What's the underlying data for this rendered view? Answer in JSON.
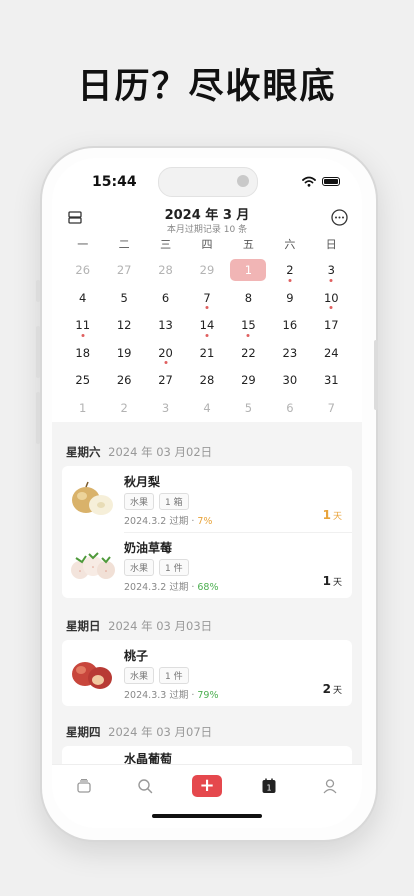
{
  "headline": "日历？尽收眼底",
  "status": {
    "time": "15:44"
  },
  "calendar": {
    "title": "2024 年 3 月",
    "subtitle": "本月过期记录 10 条",
    "weekdays": [
      "一",
      "二",
      "三",
      "四",
      "五",
      "六",
      "日"
    ],
    "weeks": [
      [
        {
          "d": "26",
          "muted": true
        },
        {
          "d": "27",
          "muted": true
        },
        {
          "d": "28",
          "muted": true
        },
        {
          "d": "29",
          "muted": true
        },
        {
          "d": "1",
          "today": true
        },
        {
          "d": "2",
          "dot": true
        },
        {
          "d": "3",
          "dot": true
        }
      ],
      [
        {
          "d": "4"
        },
        {
          "d": "5"
        },
        {
          "d": "6"
        },
        {
          "d": "7",
          "dot": true
        },
        {
          "d": "8"
        },
        {
          "d": "9"
        },
        {
          "d": "10",
          "dot": true
        }
      ],
      [
        {
          "d": "11",
          "dot": true
        },
        {
          "d": "12"
        },
        {
          "d": "13"
        },
        {
          "d": "14",
          "dot": true
        },
        {
          "d": "15",
          "dot": true
        },
        {
          "d": "16"
        },
        {
          "d": "17"
        }
      ],
      [
        {
          "d": "18"
        },
        {
          "d": "19"
        },
        {
          "d": "20",
          "dot": true
        },
        {
          "d": "21"
        },
        {
          "d": "22"
        },
        {
          "d": "23"
        },
        {
          "d": "24"
        }
      ],
      [
        {
          "d": "25"
        },
        {
          "d": "26"
        },
        {
          "d": "27"
        },
        {
          "d": "28"
        },
        {
          "d": "29"
        },
        {
          "d": "30"
        },
        {
          "d": "31"
        }
      ],
      [
        {
          "d": "1",
          "muted": true
        },
        {
          "d": "2",
          "muted": true
        },
        {
          "d": "3",
          "muted": true
        },
        {
          "d": "4",
          "muted": true
        },
        {
          "d": "5",
          "muted": true
        },
        {
          "d": "6",
          "muted": true
        },
        {
          "d": "7",
          "muted": true
        }
      ]
    ]
  },
  "sections": [
    {
      "weekday": "星期六",
      "date": "2024 年 03 月02日",
      "items": [
        {
          "name": "秋月梨",
          "category": "水果",
          "qty": "1 箱",
          "expire": "2024.3.2 过期 · ",
          "pct": "7%",
          "days": "1",
          "unit": "天",
          "icon": "pear-icon"
        },
        {
          "name": "奶油草莓",
          "category": "水果",
          "qty": "1 件",
          "expire": "2024.3.2 过期 · ",
          "pct": "68%",
          "days": "1",
          "unit": "天",
          "icon": "strawberry-icon"
        }
      ]
    },
    {
      "weekday": "星期日",
      "date": "2024 年 03 月03日",
      "items": [
        {
          "name": "桃子",
          "category": "水果",
          "qty": "1 件",
          "expire": "2024.3.3 过期 · ",
          "pct": "79%",
          "days": "2",
          "unit": "天",
          "icon": "peach-icon"
        }
      ]
    },
    {
      "weekday": "星期四",
      "date": "2024 年 03 月07日",
      "items": [
        {
          "name": "水晶葡萄",
          "partial": true
        }
      ]
    }
  ],
  "tabbar": {
    "tabs": [
      "inventory-icon",
      "search-icon",
      "add-icon",
      "calendar-icon",
      "profile-icon"
    ],
    "add_label": "+",
    "calendar_badge": "1",
    "accent": "#e5484d"
  },
  "colors": {
    "today": "#f1b5b5",
    "dot": "#e06060",
    "orange": "#e8a33a",
    "green": "#4caf50"
  }
}
